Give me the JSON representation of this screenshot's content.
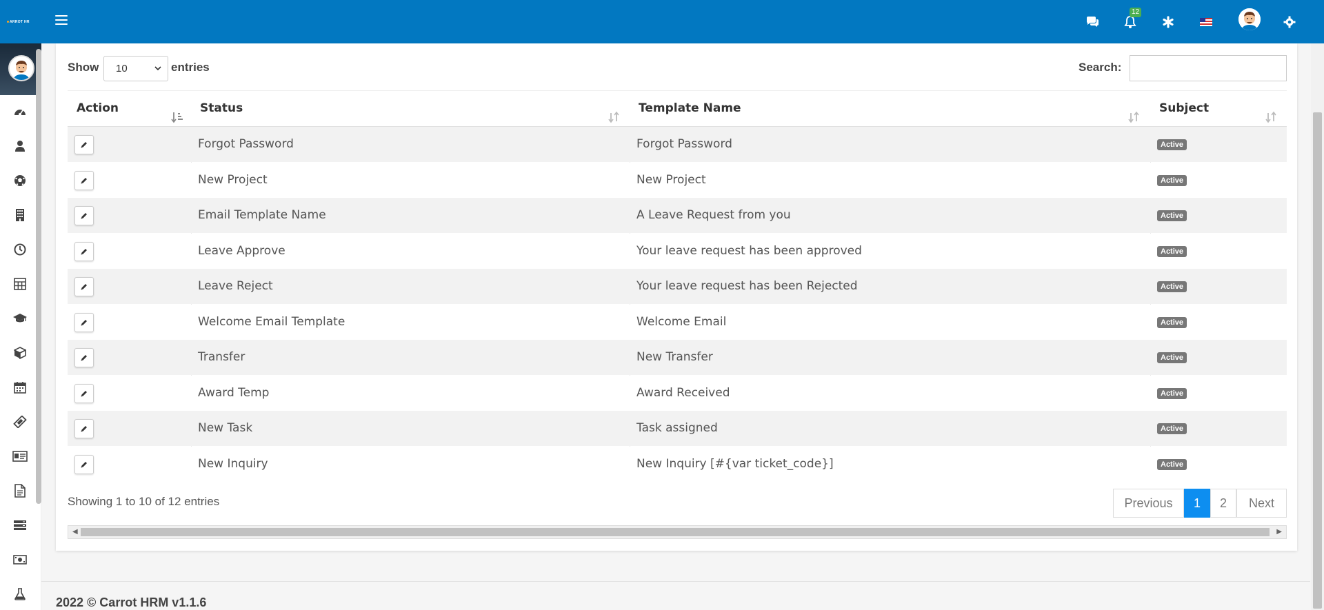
{
  "app": {
    "logo_text": "ARROT HR",
    "footer": "2022 © Carrot HRM v1.1.6"
  },
  "navbar": {
    "notification_count": "12",
    "icons": [
      "chat-icon",
      "bell-icon",
      "asterisk-icon",
      "flag-icon",
      "avatar",
      "gear-icon"
    ]
  },
  "sidebar": {
    "icons": [
      "dashboard-icon",
      "user-icon",
      "soccer-icon",
      "building-icon",
      "clock-icon",
      "calculator-icon",
      "graduation-cap-icon",
      "box-icon",
      "calendar-icon",
      "ticket-icon",
      "id-card-icon",
      "document-icon",
      "server-icon",
      "money-icon",
      "flask-icon"
    ]
  },
  "table_controls": {
    "show_label": "Show",
    "entries_value": "10",
    "entries_suffix": "entries",
    "search_label": "Search:",
    "search_value": ""
  },
  "table": {
    "headers": [
      "Action",
      "Status",
      "Template Name",
      "Subject"
    ],
    "rows": [
      {
        "status": "Forgot Password",
        "template": "Forgot Password",
        "subject": "Active"
      },
      {
        "status": "New Project",
        "template": "New Project",
        "subject": "Active"
      },
      {
        "status": "Email Template Name",
        "template": "A Leave Request from you",
        "subject": "Active"
      },
      {
        "status": "Leave Approve",
        "template": "Your leave request has been approved",
        "subject": "Active"
      },
      {
        "status": "Leave Reject",
        "template": "Your leave request has been Rejected",
        "subject": "Active"
      },
      {
        "status": "Welcome Email Template",
        "template": "Welcome Email",
        "subject": "Active"
      },
      {
        "status": "Transfer",
        "template": "New Transfer",
        "subject": "Active"
      },
      {
        "status": "Award Temp",
        "template": "Award Received",
        "subject": "Active"
      },
      {
        "status": "New Task",
        "template": "Task assigned",
        "subject": "Active"
      },
      {
        "status": "New Inquiry",
        "template": "New Inquiry [#{var ticket_code}]",
        "subject": "Active"
      }
    ]
  },
  "pagination": {
    "info": "Showing 1 to 10 of 12 entries",
    "previous": "Previous",
    "pages": [
      "1",
      "2"
    ],
    "current_page": "1",
    "next": "Next"
  },
  "colors": {
    "navbar": "#0278c1",
    "active_page": "#0d8ef0",
    "badge": "#777777",
    "notification_badge": "#4caf50"
  }
}
